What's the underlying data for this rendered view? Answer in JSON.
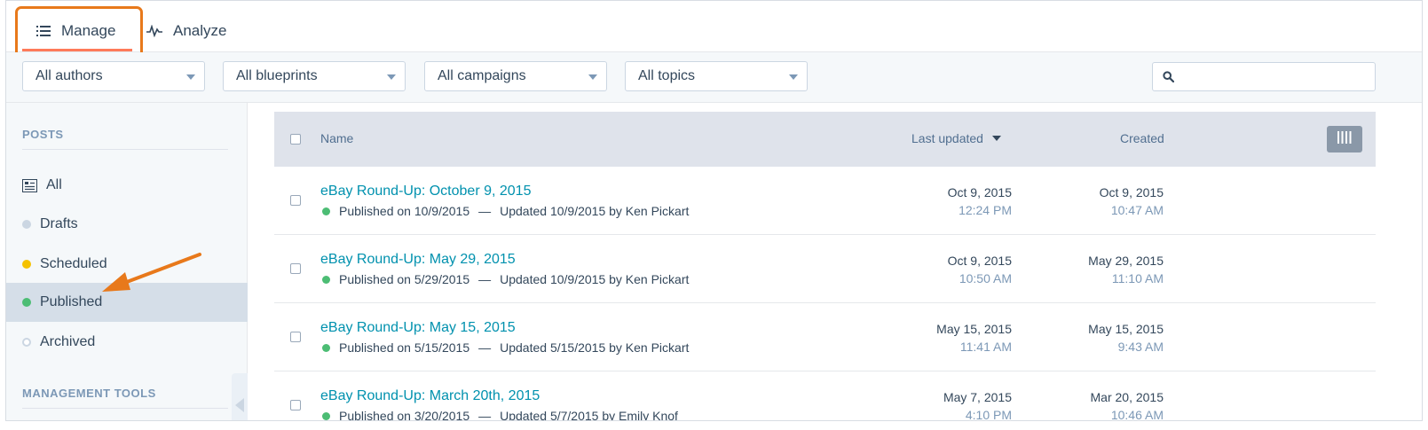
{
  "tabs": {
    "manage": "Manage",
    "analyze": "Analyze"
  },
  "filters": {
    "authors": "All authors",
    "blueprints": "All blueprints",
    "campaigns": "All campaigns",
    "topics": "All topics",
    "search_placeholder": ""
  },
  "sidebar": {
    "posts_heading": "POSTS",
    "items": [
      {
        "label": "All",
        "icon": "list-icon"
      },
      {
        "label": "Drafts",
        "dot_color": "#cbd6e2"
      },
      {
        "label": "Scheduled",
        "dot_color": "#f5c26b"
      },
      {
        "label": "Published",
        "dot_color": "#00bda5",
        "active": true
      },
      {
        "label": "Archived",
        "dot_color": "hollow"
      }
    ],
    "tools_heading": "MANAGEMENT TOOLS"
  },
  "table": {
    "columns": {
      "name": "Name",
      "updated": "Last updated",
      "created": "Created"
    },
    "rows": [
      {
        "title": "eBay Round-Up: October 9, 2015",
        "published": "Published on 10/9/2015",
        "updated_by": "Updated 10/9/2015 by Ken Pickart",
        "updated_date": "Oct 9, 2015",
        "updated_time": "12:24 PM",
        "created_date": "Oct 9, 2015",
        "created_time": "10:47 AM"
      },
      {
        "title": "eBay Round-Up: May 29, 2015",
        "published": "Published on 5/29/2015",
        "updated_by": "Updated 10/9/2015 by Ken Pickart",
        "updated_date": "Oct 9, 2015",
        "updated_time": "10:50 AM",
        "created_date": "May 29, 2015",
        "created_time": "11:10 AM"
      },
      {
        "title": "eBay Round-Up: May 15, 2015",
        "published": "Published on 5/15/2015",
        "updated_by": "Updated 5/15/2015 by Ken Pickart",
        "updated_date": "May 15, 2015",
        "updated_time": "11:41 AM",
        "created_date": "May 15, 2015",
        "created_time": "9:43 AM"
      },
      {
        "title": "eBay Round-Up: March 20th, 2015",
        "published": "Published on 3/20/2015",
        "updated_by": "Updated 5/7/2015 by Emily Knof",
        "updated_date": "May 7, 2015",
        "updated_time": "4:10 PM",
        "created_date": "Mar 20, 2015",
        "created_time": "10:46 AM"
      }
    ]
  },
  "colors": {
    "accent_orange": "#e8791b",
    "link": "#0091ae",
    "published_green": "#4cbd74"
  }
}
